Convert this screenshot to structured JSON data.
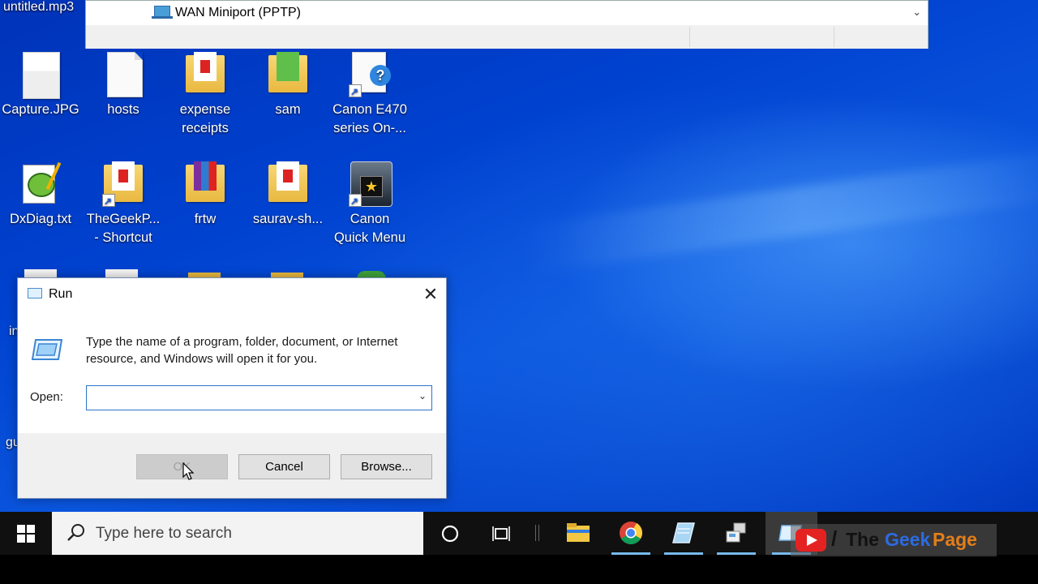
{
  "desktop": {
    "top_left_file": "untitled.mp3",
    "icons": [
      {
        "label": "Capture.JPG"
      },
      {
        "label": "hosts"
      },
      {
        "label": "expense\nreceipts"
      },
      {
        "label": "sam"
      },
      {
        "label": "Canon E470\nseries On-..."
      },
      {
        "label": "DxDiag.txt"
      },
      {
        "label": "TheGeekP...\n- Shortcut"
      },
      {
        "label": "frtw"
      },
      {
        "label": "saurav-sh..."
      },
      {
        "label": "Canon\nQuick Menu"
      }
    ],
    "partial_labels": [
      "in",
      "gu"
    ]
  },
  "top_window": {
    "row_text": "WAN Miniport (PPTP)"
  },
  "run_dialog": {
    "title": "Run",
    "message": "Type the name of a program, folder, document, or Internet resource, and Windows will open it for you.",
    "open_label": "Open:",
    "open_value": "",
    "ok_label": "OK",
    "cancel_label": "Cancel",
    "browse_label": "Browse..."
  },
  "taskbar": {
    "search_placeholder": "Type here to search",
    "pinned": [
      "cortana-icon",
      "task-view-icon",
      "file-explorer-icon",
      "chrome-icon",
      "notepad-icon",
      "network-icon",
      "run-icon"
    ]
  },
  "watermark": {
    "slash": "/",
    "word1": "The",
    "word2": "Geek",
    "word3": "Page"
  },
  "colors": {
    "desktop_blue": "#0042d0",
    "accent": "#2a73c9",
    "taskbar": "#101010"
  }
}
